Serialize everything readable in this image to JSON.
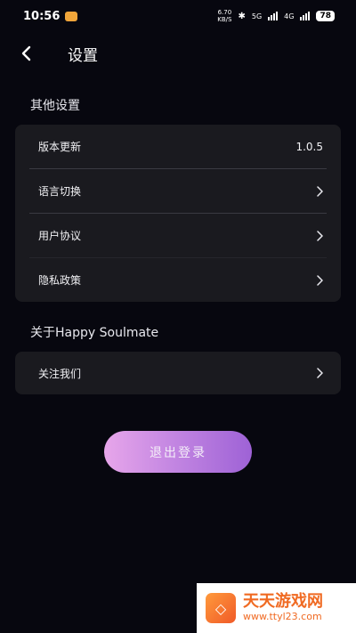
{
  "status_bar": {
    "time": "10:56",
    "net_speed_value": "6.70",
    "net_speed_unit": "KB/S",
    "network_1": "5G",
    "network_2": "4G",
    "battery": "78",
    "icons": [
      "notification-app-icon",
      "bluetooth-icon",
      "signal-icon",
      "battery-icon"
    ]
  },
  "header": {
    "title": "设置",
    "back_icon": "chevron-left-icon"
  },
  "other_settings": {
    "section_title": "其他设置",
    "items": [
      {
        "label": "版本更新",
        "value": "1.0.5"
      },
      {
        "label": "语言切换",
        "icon": "chevron-right-icon"
      },
      {
        "label": "用户协议",
        "icon": "chevron-right-icon"
      },
      {
        "label": "隐私政策",
        "icon": "chevron-right-icon"
      }
    ]
  },
  "about": {
    "section_title": "关于Happy Soulmate",
    "items": [
      {
        "label": "关注我们",
        "icon": "chevron-right-icon"
      }
    ]
  },
  "logout_label": "退出登录",
  "watermark": {
    "title": "天天游戏网",
    "url": "www.ttyl23.com"
  },
  "colors": {
    "background": "#07070f",
    "card": "#1a1a1f",
    "gradient_start": "#e7a6ea",
    "gradient_end": "#9e62d6",
    "watermark_accent": "#f06a22"
  }
}
